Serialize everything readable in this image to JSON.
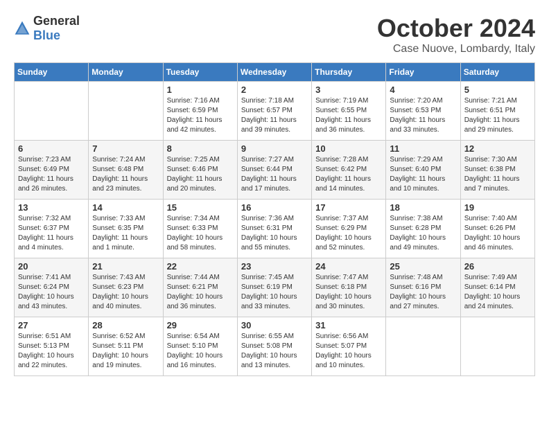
{
  "header": {
    "logo_general": "General",
    "logo_blue": "Blue",
    "month": "October 2024",
    "location": "Case Nuove, Lombardy, Italy"
  },
  "days_of_week": [
    "Sunday",
    "Monday",
    "Tuesday",
    "Wednesday",
    "Thursday",
    "Friday",
    "Saturday"
  ],
  "weeks": [
    [
      {
        "day": "",
        "content": ""
      },
      {
        "day": "",
        "content": ""
      },
      {
        "day": "1",
        "content": "Sunrise: 7:16 AM\nSunset: 6:59 PM\nDaylight: 11 hours and 42 minutes."
      },
      {
        "day": "2",
        "content": "Sunrise: 7:18 AM\nSunset: 6:57 PM\nDaylight: 11 hours and 39 minutes."
      },
      {
        "day": "3",
        "content": "Sunrise: 7:19 AM\nSunset: 6:55 PM\nDaylight: 11 hours and 36 minutes."
      },
      {
        "day": "4",
        "content": "Sunrise: 7:20 AM\nSunset: 6:53 PM\nDaylight: 11 hours and 33 minutes."
      },
      {
        "day": "5",
        "content": "Sunrise: 7:21 AM\nSunset: 6:51 PM\nDaylight: 11 hours and 29 minutes."
      }
    ],
    [
      {
        "day": "6",
        "content": "Sunrise: 7:23 AM\nSunset: 6:49 PM\nDaylight: 11 hours and 26 minutes."
      },
      {
        "day": "7",
        "content": "Sunrise: 7:24 AM\nSunset: 6:48 PM\nDaylight: 11 hours and 23 minutes."
      },
      {
        "day": "8",
        "content": "Sunrise: 7:25 AM\nSunset: 6:46 PM\nDaylight: 11 hours and 20 minutes."
      },
      {
        "day": "9",
        "content": "Sunrise: 7:27 AM\nSunset: 6:44 PM\nDaylight: 11 hours and 17 minutes."
      },
      {
        "day": "10",
        "content": "Sunrise: 7:28 AM\nSunset: 6:42 PM\nDaylight: 11 hours and 14 minutes."
      },
      {
        "day": "11",
        "content": "Sunrise: 7:29 AM\nSunset: 6:40 PM\nDaylight: 11 hours and 10 minutes."
      },
      {
        "day": "12",
        "content": "Sunrise: 7:30 AM\nSunset: 6:38 PM\nDaylight: 11 hours and 7 minutes."
      }
    ],
    [
      {
        "day": "13",
        "content": "Sunrise: 7:32 AM\nSunset: 6:37 PM\nDaylight: 11 hours and 4 minutes."
      },
      {
        "day": "14",
        "content": "Sunrise: 7:33 AM\nSunset: 6:35 PM\nDaylight: 11 hours and 1 minute."
      },
      {
        "day": "15",
        "content": "Sunrise: 7:34 AM\nSunset: 6:33 PM\nDaylight: 10 hours and 58 minutes."
      },
      {
        "day": "16",
        "content": "Sunrise: 7:36 AM\nSunset: 6:31 PM\nDaylight: 10 hours and 55 minutes."
      },
      {
        "day": "17",
        "content": "Sunrise: 7:37 AM\nSunset: 6:29 PM\nDaylight: 10 hours and 52 minutes."
      },
      {
        "day": "18",
        "content": "Sunrise: 7:38 AM\nSunset: 6:28 PM\nDaylight: 10 hours and 49 minutes."
      },
      {
        "day": "19",
        "content": "Sunrise: 7:40 AM\nSunset: 6:26 PM\nDaylight: 10 hours and 46 minutes."
      }
    ],
    [
      {
        "day": "20",
        "content": "Sunrise: 7:41 AM\nSunset: 6:24 PM\nDaylight: 10 hours and 43 minutes."
      },
      {
        "day": "21",
        "content": "Sunrise: 7:43 AM\nSunset: 6:23 PM\nDaylight: 10 hours and 40 minutes."
      },
      {
        "day": "22",
        "content": "Sunrise: 7:44 AM\nSunset: 6:21 PM\nDaylight: 10 hours and 36 minutes."
      },
      {
        "day": "23",
        "content": "Sunrise: 7:45 AM\nSunset: 6:19 PM\nDaylight: 10 hours and 33 minutes."
      },
      {
        "day": "24",
        "content": "Sunrise: 7:47 AM\nSunset: 6:18 PM\nDaylight: 10 hours and 30 minutes."
      },
      {
        "day": "25",
        "content": "Sunrise: 7:48 AM\nSunset: 6:16 PM\nDaylight: 10 hours and 27 minutes."
      },
      {
        "day": "26",
        "content": "Sunrise: 7:49 AM\nSunset: 6:14 PM\nDaylight: 10 hours and 24 minutes."
      }
    ],
    [
      {
        "day": "27",
        "content": "Sunrise: 6:51 AM\nSunset: 5:13 PM\nDaylight: 10 hours and 22 minutes."
      },
      {
        "day": "28",
        "content": "Sunrise: 6:52 AM\nSunset: 5:11 PM\nDaylight: 10 hours and 19 minutes."
      },
      {
        "day": "29",
        "content": "Sunrise: 6:54 AM\nSunset: 5:10 PM\nDaylight: 10 hours and 16 minutes."
      },
      {
        "day": "30",
        "content": "Sunrise: 6:55 AM\nSunset: 5:08 PM\nDaylight: 10 hours and 13 minutes."
      },
      {
        "day": "31",
        "content": "Sunrise: 6:56 AM\nSunset: 5:07 PM\nDaylight: 10 hours and 10 minutes."
      },
      {
        "day": "",
        "content": ""
      },
      {
        "day": "",
        "content": ""
      }
    ]
  ]
}
